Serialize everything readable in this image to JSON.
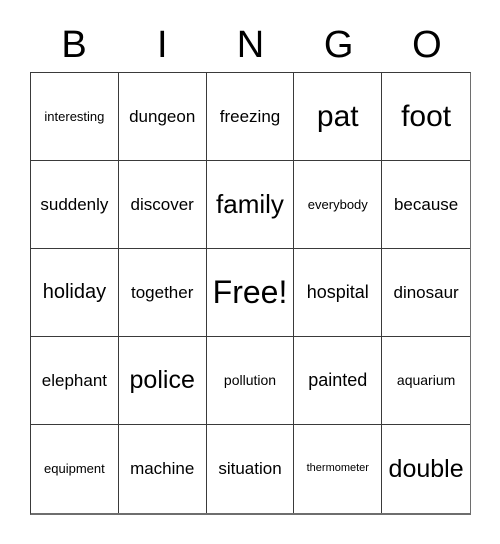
{
  "card": {
    "header_letters": [
      "B",
      "I",
      "N",
      "G",
      "O"
    ],
    "columns": 5,
    "rows": 5,
    "background_color": "#ffffff",
    "border_color": "#3a3a3a",
    "text_color": "#000000",
    "free_space_label": "Free!",
    "free_space_position": "center",
    "cells": [
      [
        {
          "label": "interesting",
          "size": "xs"
        },
        {
          "label": "dungeon",
          "size": "m"
        },
        {
          "label": "freezing",
          "size": "m"
        },
        {
          "label": "pat",
          "size": "3xl"
        },
        {
          "label": "foot",
          "size": "3xl"
        }
      ],
      [
        {
          "label": "suddenly",
          "size": "m"
        },
        {
          "label": "discover",
          "size": "m"
        },
        {
          "label": "family",
          "size": "xxl"
        },
        {
          "label": "everybody",
          "size": "xs"
        },
        {
          "label": "because",
          "size": "m"
        }
      ],
      [
        {
          "label": "holiday",
          "size": "l"
        },
        {
          "label": "together",
          "size": "m"
        },
        {
          "label": "Free!",
          "size": "4xl"
        },
        {
          "label": "hospital",
          "size": "ml"
        },
        {
          "label": "dinosaur",
          "size": "m"
        }
      ],
      [
        {
          "label": "elephant",
          "size": "m"
        },
        {
          "label": "police",
          "size": "xl"
        },
        {
          "label": "pollution",
          "size": "s"
        },
        {
          "label": "painted",
          "size": "ml"
        },
        {
          "label": "aquarium",
          "size": "s"
        }
      ],
      [
        {
          "label": "equipment",
          "size": "xs"
        },
        {
          "label": "machine",
          "size": "m"
        },
        {
          "label": "situation",
          "size": "m"
        },
        {
          "label": "thermometer",
          "size": "xxs"
        },
        {
          "label": "double",
          "size": "xl"
        }
      ]
    ]
  }
}
